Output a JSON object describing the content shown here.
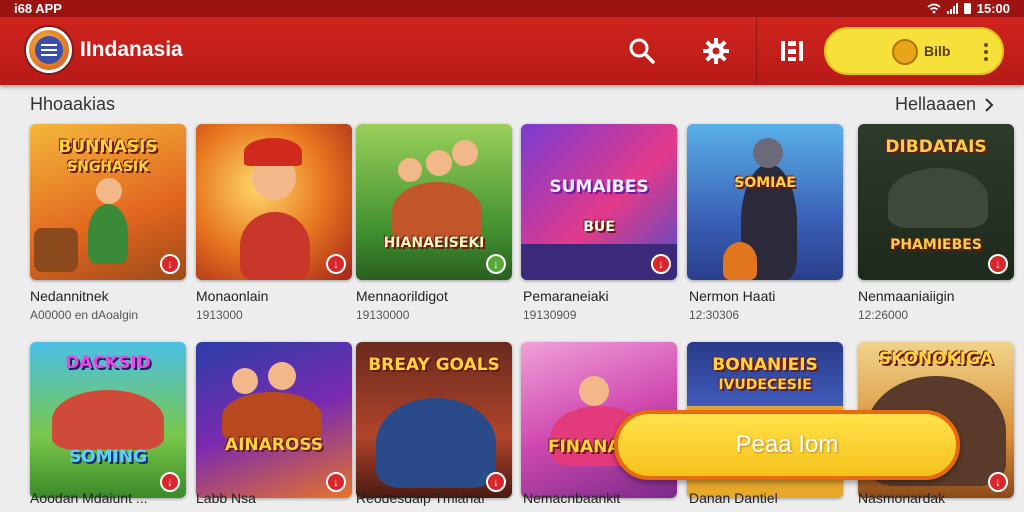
{
  "status": {
    "app_label": "i68 APP",
    "time": "15:00"
  },
  "header": {
    "title": "IIndanasia",
    "badge_label": "Bilb"
  },
  "section": {
    "title": "Hhoaakias",
    "link": "Hellaaaen"
  },
  "row1": [
    {
      "art": "BUNNASIS",
      "art2": "SNGHASIK",
      "name": "Nedannitnek",
      "sub": "A00000 en dAoalgin"
    },
    {
      "art": "",
      "art2": "",
      "name": "Monaonlain",
      "sub": "1913000"
    },
    {
      "art": "HIANAEISEKI",
      "art2": "",
      "name": "Mennaorildigot",
      "sub": "19130000"
    },
    {
      "art": "SUMAIBES",
      "art2": "BUE",
      "name": "Pemaraneiaki",
      "sub": "19130909"
    },
    {
      "art": "SOMIAE",
      "art2": "",
      "name": "Nermon Haati",
      "sub": "12:30306"
    },
    {
      "art": "DIBDATAIS",
      "art2": "PHAMIEBES",
      "name": "Nenmaaniaiigin",
      "sub": "12:26000"
    }
  ],
  "row2": [
    {
      "art": "DACKSID",
      "art2": "SOMING",
      "name": "Aoodan Mdaiunt ...",
      "sub": ""
    },
    {
      "art": "AINAROSS",
      "art2": "",
      "name": "Labb Nsa",
      "sub": ""
    },
    {
      "art": "BREAY GOALS",
      "art2": "",
      "name": "Reodesdaip Tmlahaı",
      "sub": ""
    },
    {
      "art": "FINANAEIE",
      "art2": "",
      "name": "Nemacnbaankit",
      "sub": ""
    },
    {
      "art": "BONANIEIS",
      "art2": "IVUDECESIE",
      "name": "Danan Dantiel",
      "sub": ""
    },
    {
      "art": "SKONOKIGA",
      "art2": "",
      "name": "Nasmonardak",
      "sub": ""
    }
  ],
  "cta": {
    "label": "Peaa Iom"
  }
}
